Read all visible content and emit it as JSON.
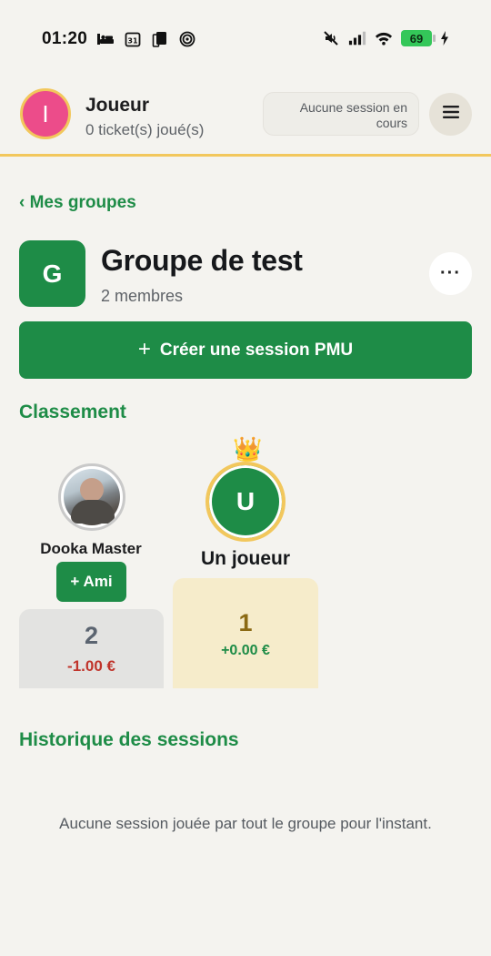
{
  "status_bar": {
    "time": "01:20",
    "battery": "69",
    "left_icons": [
      "sleep-icon",
      "calendar-icon",
      "sim-icon",
      "spiral-icon"
    ],
    "right_icons": [
      "mute-icon",
      "signal-icon",
      "wifi-icon",
      "battery-icon",
      "charging-icon"
    ]
  },
  "header": {
    "avatar_letter": "I",
    "avatar_color": "#ec4c8a",
    "user_name": "Joueur",
    "tickets": "0 ticket(s) joué(s)",
    "session_status": "Aucune session en cours"
  },
  "nav": {
    "back_label": "‹ Mes groupes"
  },
  "group": {
    "avatar_letter": "G",
    "name": "Groupe de test",
    "members": "2 membres",
    "more_label": "···"
  },
  "actions": {
    "create_plus": "+",
    "create_label": "Créer une session PMU"
  },
  "ranking": {
    "title": "Classement",
    "players": [
      {
        "rank": "2",
        "name": "Dooka Master",
        "amount": "-1.00 €",
        "friend_label": "+ Ami"
      },
      {
        "rank": "1",
        "name": "Un joueur",
        "initial": "U",
        "amount": "+0.00 €",
        "crown": "👑"
      }
    ]
  },
  "history": {
    "title": "Historique des sessions",
    "empty": "Aucune session jouée par tout le groupe pour l'instant."
  },
  "colors": {
    "brand_green": "#1e8c47",
    "gold": "#f2c75c",
    "negative": "#c0342b"
  }
}
